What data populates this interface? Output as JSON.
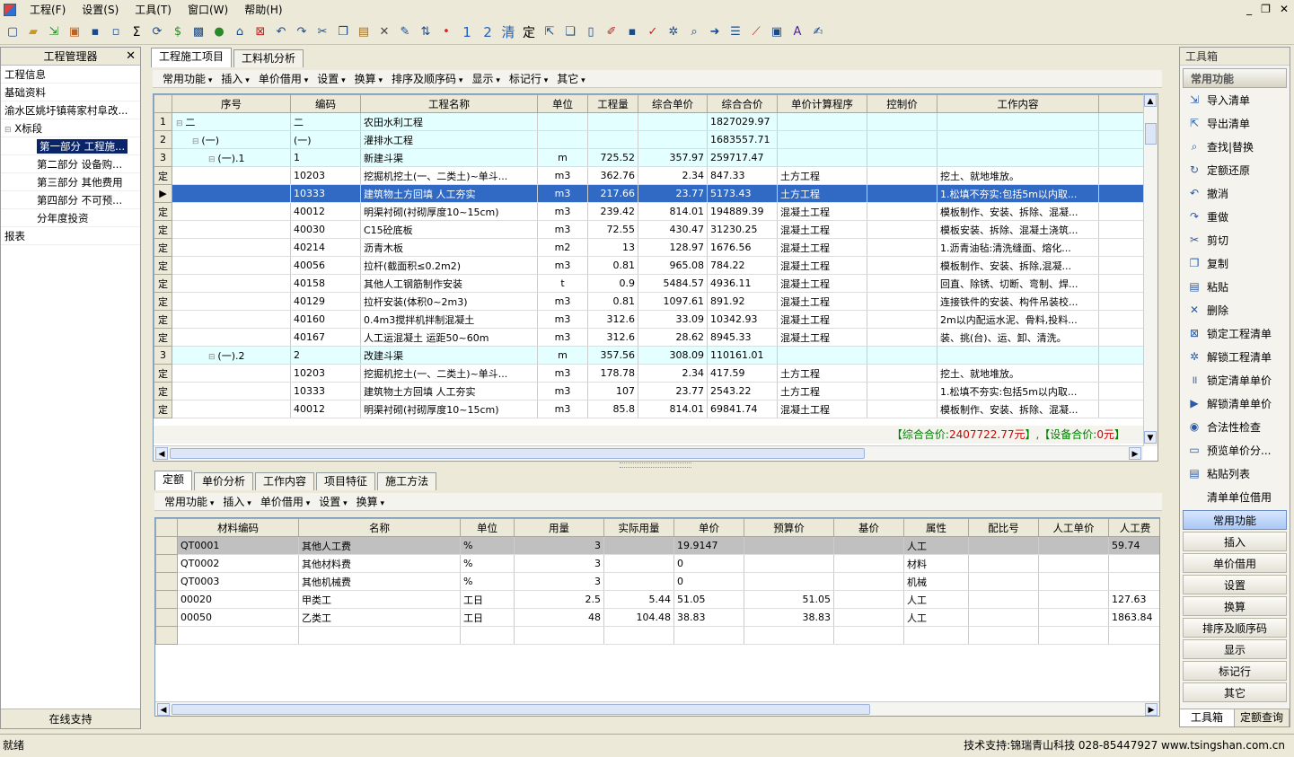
{
  "menu": [
    "工程(F)",
    "设置(S)",
    "工具(T)",
    "窗口(W)",
    "帮助(H)"
  ],
  "window_controls": [
    "_",
    "❐",
    "✕"
  ],
  "toolbar_text": {
    "sigma": "Σ",
    "one": "1",
    "two": "2",
    "qing": "清",
    "ding": "定"
  },
  "left_panel": {
    "title": "工程管理器",
    "items": [
      {
        "label": "工程信息"
      },
      {
        "label": "基础资料"
      },
      {
        "label": "渝水区姚圩镇蒋家村阜改..."
      },
      {
        "label": "X标段"
      },
      {
        "label": "第一部分 工程施..."
      },
      {
        "label": "第二部分 设备购..."
      },
      {
        "label": "第三部分 其他费用"
      },
      {
        "label": "第四部分 不可预..."
      },
      {
        "label": "分年度投资"
      },
      {
        "label": "报表"
      }
    ],
    "footer": "在线支持"
  },
  "main_tabs": [
    "工程施工项目",
    "工料机分析"
  ],
  "main_menu": [
    "常用功能",
    "插入",
    "单价借用",
    "设置",
    "换算",
    "排序及顺序码",
    "显示",
    "标记行",
    "其它"
  ],
  "main_grid": {
    "columns": [
      "序号",
      "编码",
      "工程名称",
      "单位",
      "工程量",
      "综合单价",
      "综合合价",
      "单价计算程序",
      "控制价",
      "工作内容"
    ],
    "rows": [
      {
        "h": "1",
        "seq": "二",
        "code": "二",
        "name": "农田水利工程",
        "unit": "",
        "qty": "",
        "price": "",
        "total": "1827029.97",
        "prog": "",
        "ctrl": "",
        "work": ""
      },
      {
        "h": "2",
        "seq": "(一)",
        "code": "(一)",
        "name": "灌排水工程",
        "unit": "",
        "qty": "",
        "price": "",
        "total": "1683557.71",
        "prog": "",
        "ctrl": "",
        "work": ""
      },
      {
        "h": "3",
        "seq": "(一).1",
        "code": "1",
        "name": "新建斗渠",
        "unit": "m",
        "qty": "725.52",
        "price": "357.97",
        "total": "259717.47",
        "prog": "",
        "ctrl": "",
        "work": ""
      },
      {
        "h": "定",
        "seq": "",
        "code": "10203",
        "name": "挖掘机挖土(一、二类土)~单斗...",
        "unit": "m3",
        "qty": "362.76",
        "price": "2.34",
        "total": "847.33",
        "prog": "土方工程",
        "ctrl": "",
        "work": "挖土、就地堆放。"
      },
      {
        "h": "▶",
        "seq": "",
        "code": "10333",
        "name": "建筑物土方回填 人工夯实",
        "unit": "m3",
        "qty": "217.66",
        "price": "23.77",
        "total": "5173.43",
        "prog": "土方工程",
        "ctrl": "",
        "work": "1.松填不夯实:包括5m以内取..."
      },
      {
        "h": "定",
        "seq": "",
        "code": "40012",
        "name": "明渠衬砌(衬砌厚度10~15cm)",
        "unit": "m3",
        "qty": "239.42",
        "price": "814.01",
        "total": "194889.39",
        "prog": "混凝土工程",
        "ctrl": "",
        "work": "模板制作、安装、拆除、混凝..."
      },
      {
        "h": "定",
        "seq": "",
        "code": "40030",
        "name": "C15砼底板",
        "unit": "m3",
        "qty": "72.55",
        "price": "430.47",
        "total": "31230.25",
        "prog": "混凝土工程",
        "ctrl": "",
        "work": "模板安装、拆除、混凝土浇筑..."
      },
      {
        "h": "定",
        "seq": "",
        "code": "40214",
        "name": "沥青木板",
        "unit": "m2",
        "qty": "13",
        "price": "128.97",
        "total": "1676.56",
        "prog": "混凝土工程",
        "ctrl": "",
        "work": "1.沥青油毡:清洗缝面、熔化..."
      },
      {
        "h": "定",
        "seq": "",
        "code": "40056",
        "name": "拉杆(截面积≤0.2m2)",
        "unit": "m3",
        "qty": "0.81",
        "price": "965.08",
        "total": "784.22",
        "prog": "混凝土工程",
        "ctrl": "",
        "work": "模板制作、安装、拆除,混凝..."
      },
      {
        "h": "定",
        "seq": "",
        "code": "40158",
        "name": "其他人工钢筋制作安装",
        "unit": "t",
        "qty": "0.9",
        "price": "5484.57",
        "total": "4936.11",
        "prog": "混凝土工程",
        "ctrl": "",
        "work": "回直、除锈、切断、弯制、焊..."
      },
      {
        "h": "定",
        "seq": "",
        "code": "40129",
        "name": "拉杆安装(体积0~2m3)",
        "unit": "m3",
        "qty": "0.81",
        "price": "1097.61",
        "total": "891.92",
        "prog": "混凝土工程",
        "ctrl": "",
        "work": "连接铁件的安装、构件吊装校..."
      },
      {
        "h": "定",
        "seq": "",
        "code": "40160",
        "name": "0.4m3搅拌机拌制混凝土",
        "unit": "m3",
        "qty": "312.6",
        "price": "33.09",
        "total": "10342.93",
        "prog": "混凝土工程",
        "ctrl": "",
        "work": "2m以内配运水泥、骨料,投料..."
      },
      {
        "h": "定",
        "seq": "",
        "code": "40167",
        "name": "人工运混凝土 运距50~60m",
        "unit": "m3",
        "qty": "312.6",
        "price": "28.62",
        "total": "8945.33",
        "prog": "混凝土工程",
        "ctrl": "",
        "work": "装、挑(台)、运、卸、清洗。"
      },
      {
        "h": "3",
        "seq": "(一).2",
        "code": "2",
        "name": "改建斗渠",
        "unit": "m",
        "qty": "357.56",
        "price": "308.09",
        "total": "110161.01",
        "prog": "",
        "ctrl": "",
        "work": ""
      },
      {
        "h": "定",
        "seq": "",
        "code": "10203",
        "name": "挖掘机挖土(一、二类土)~单斗...",
        "unit": "m3",
        "qty": "178.78",
        "price": "2.34",
        "total": "417.59",
        "prog": "土方工程",
        "ctrl": "",
        "work": "挖土、就地堆放。"
      },
      {
        "h": "定",
        "seq": "",
        "code": "10333",
        "name": "建筑物土方回填 人工夯实",
        "unit": "m3",
        "qty": "107",
        "price": "23.77",
        "total": "2543.22",
        "prog": "土方工程",
        "ctrl": "",
        "work": "1.松填不夯实:包括5m以内取..."
      },
      {
        "h": "定",
        "seq": "",
        "code": "40012",
        "name": "明渠衬砌(衬砌厚度10~15cm)",
        "unit": "m3",
        "qty": "85.8",
        "price": "814.01",
        "total": "69841.74",
        "prog": "混凝土工程",
        "ctrl": "",
        "work": "模板制作、安装、拆除、混凝..."
      }
    ]
  },
  "totals": {
    "a": "【综合合价:",
    "b": "2407722.77元",
    "c": "】,【设备合价:",
    "d": "0元",
    "e": "】"
  },
  "bottom_tabs": [
    "定额",
    "单价分析",
    "工作内容",
    "项目特征",
    "施工方法"
  ],
  "bottom_menu": [
    "常用功能",
    "插入",
    "单价借用",
    "设置",
    "换算"
  ],
  "bottom_grid": {
    "columns": [
      "材料编码",
      "名称",
      "单位",
      "用量",
      "实际用量",
      "单价",
      "预算价",
      "基价",
      "属性",
      "配比号",
      "人工单价",
      "人工费"
    ],
    "rows": [
      {
        "code": "QT0001",
        "name": "其他人工费",
        "unit": "%",
        "use": "3",
        "act": "",
        "price": "19.9147",
        "budget": "",
        "base": "",
        "attr": "人工",
        "mix": "",
        "lp": "",
        "lf": "59.74"
      },
      {
        "code": "QT0002",
        "name": "其他材料费",
        "unit": "%",
        "use": "3",
        "act": "",
        "price": "0",
        "budget": "",
        "base": "",
        "attr": "材料",
        "mix": "",
        "lp": "",
        "lf": ""
      },
      {
        "code": "QT0003",
        "name": "其他机械费",
        "unit": "%",
        "use": "3",
        "act": "",
        "price": "0",
        "budget": "",
        "base": "",
        "attr": "机械",
        "mix": "",
        "lp": "",
        "lf": ""
      },
      {
        "code": "00020",
        "name": "甲类工",
        "unit": "工日",
        "use": "2.5",
        "act": "5.44",
        "price": "51.05",
        "budget": "51.05",
        "base": "",
        "attr": "人工",
        "mix": "",
        "lp": "",
        "lf": "127.63"
      },
      {
        "code": "00050",
        "name": "乙类工",
        "unit": "工日",
        "use": "48",
        "act": "104.48",
        "price": "38.83",
        "budget": "38.83",
        "base": "",
        "attr": "人工",
        "mix": "",
        "lp": "",
        "lf": "1863.84"
      }
    ]
  },
  "right_panel": {
    "title": "工具箱",
    "category": "常用功能",
    "items": [
      {
        "label": "导入清单",
        "icon": "import-icon",
        "glyph": "⇲"
      },
      {
        "label": "导出清单",
        "icon": "export-icon",
        "glyph": "⇱"
      },
      {
        "label": "查找|替换",
        "icon": "binoculars-icon",
        "glyph": "⌕"
      },
      {
        "label": "定额还原",
        "icon": "restore-icon",
        "glyph": "↻"
      },
      {
        "label": "撤消",
        "icon": "undo-icon",
        "glyph": "↶"
      },
      {
        "label": "重做",
        "icon": "redo-icon",
        "glyph": "↷"
      },
      {
        "label": "剪切",
        "icon": "scissors-icon",
        "glyph": "✂"
      },
      {
        "label": "复制",
        "icon": "copy-icon",
        "glyph": "❐"
      },
      {
        "label": "粘贴",
        "icon": "paste-icon",
        "glyph": "▤"
      },
      {
        "label": "删除",
        "icon": "delete-icon",
        "glyph": "✕"
      },
      {
        "label": "锁定工程清单",
        "icon": "lock-icon",
        "glyph": "⊠"
      },
      {
        "label": "解锁工程清单",
        "icon": "unlock-icon",
        "glyph": "✲"
      },
      {
        "label": "锁定清单单价",
        "icon": "pause-icon",
        "glyph": "॥"
      },
      {
        "label": "解锁清单单价",
        "icon": "play-icon",
        "glyph": "▶"
      },
      {
        "label": "合法性检查",
        "icon": "check-icon",
        "glyph": "◉"
      },
      {
        "label": "预览单价分...",
        "icon": "preview-icon",
        "glyph": "▭"
      },
      {
        "label": "粘贴列表",
        "icon": "paste-list-icon",
        "glyph": "▤"
      },
      {
        "label": "清单单位借用",
        "icon": "borrow-icon",
        "glyph": ""
      }
    ],
    "buttons": [
      "常用功能",
      "插入",
      "单价借用",
      "设置",
      "换算",
      "排序及顺序码",
      "显示",
      "标记行",
      "其它"
    ],
    "tabs": [
      "工具箱",
      "定额查询"
    ]
  },
  "status": {
    "left": "就绪",
    "right": "技术支持:锦瑞青山科技 028-85447927 www.tsingshan.com.cn"
  }
}
